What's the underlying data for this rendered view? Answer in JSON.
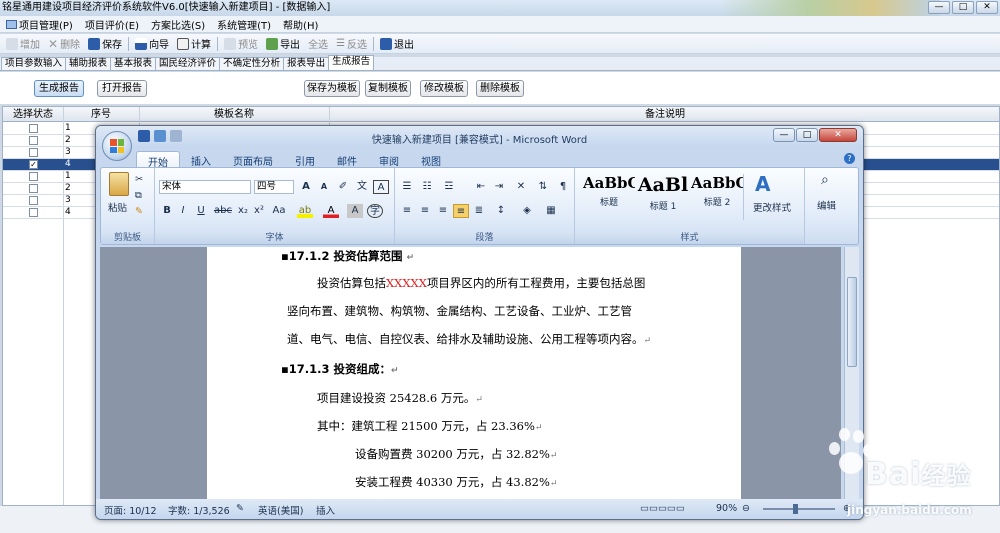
{
  "app": {
    "title": "铭星通用建设项目经济评价系统软件V6.0[快速输入新建项目] - [数据输入]",
    "win_min": "—",
    "win_max": "□",
    "win_close": "✕"
  },
  "menu": [
    {
      "label": "项目管理(P)",
      "icon": "project-icon"
    },
    {
      "label": "项目评价(E)"
    },
    {
      "label": "方案比选(S)"
    },
    {
      "label": "系统管理(T)"
    },
    {
      "label": "帮助(H)"
    }
  ],
  "toolbar": {
    "add": "增加",
    "delete": "删除",
    "save": "保存",
    "wizard": "向导",
    "calc": "计算",
    "preview": "预览",
    "export": "导出",
    "select_all": "全选",
    "invert": "反选",
    "exit": "退出"
  },
  "tabs": [
    "项目参数输入",
    "辅助报表",
    "基本报表",
    "国民经济评价",
    "不确定性分析",
    "报表导出",
    "生成报告"
  ],
  "active_tab": 6,
  "buttons": {
    "generate": "生成报告",
    "open": "打开报告",
    "save_template": "保存为模板",
    "copy_template": "复制模板",
    "edit_template": "修改模板",
    "delete_template": "删除模板"
  },
  "grid": {
    "headers": {
      "select": "选择状态",
      "no": "序号",
      "name": "模板名称",
      "note": "备注说明"
    },
    "rows": [
      {
        "no": "1",
        "checked": false
      },
      {
        "no": "2",
        "checked": false
      },
      {
        "no": "3",
        "checked": false
      },
      {
        "no": "4",
        "checked": true
      },
      {
        "no": "1",
        "checked": false
      },
      {
        "no": "2",
        "checked": false
      },
      {
        "no": "3",
        "checked": false
      },
      {
        "no": "4",
        "checked": false
      }
    ],
    "selected_row": 3
  },
  "word": {
    "title": "快速输入新建项目 [兼容模式] - Microsoft Word",
    "ribbon_tabs": [
      "开始",
      "插入",
      "页面布局",
      "引用",
      "邮件",
      "审阅",
      "视图"
    ],
    "active_ribbon_tab": 0,
    "clipboard": {
      "paste": "粘贴",
      "label": "剪贴板"
    },
    "font": {
      "name": "宋体",
      "size": "四号",
      "label": "字体"
    },
    "paragraph_label": "段落",
    "styles": [
      {
        "preview": "AaBbC(",
        "name": "标题"
      },
      {
        "preview": "AaBl",
        "name": "标题 1"
      },
      {
        "preview": "AaBbC",
        "name": "标题 2"
      }
    ],
    "change_styles": "更改样式",
    "styles_label": "样式",
    "editing": "编辑",
    "doc": {
      "h1": "17.1.2 投资估算范围",
      "p1a": "投资估算包括",
      "p1_red": "XXXXX",
      "p1b": "项目界区内的所有工程费用，主要包括总图",
      "p2": "竖向布置、建筑物、构筑物、金属结构、工艺设备、工业炉、工艺管",
      "p3": "道、电气、电信、自控仪表、给排水及辅助设施、公用工程等项内容。",
      "h2": "17.1.3 投资组成：",
      "l1": "项目建设投资 25428.6 万元。",
      "l2": "其中：建筑工程 21500 万元，占 23.36%",
      "l3": "设备购置费 30200 万元，占 32.82%",
      "l4": "安装工程费 40330 万元，占 43.82%"
    },
    "status": {
      "page": "页面: 10/12",
      "words": "字数: 1/3,526",
      "lang": "英语(美国)",
      "mode": "插入",
      "zoom": "90%"
    }
  },
  "watermark": {
    "brand": "Bai",
    "brand2": "经验",
    "url": "jingyan.baidu.com"
  }
}
